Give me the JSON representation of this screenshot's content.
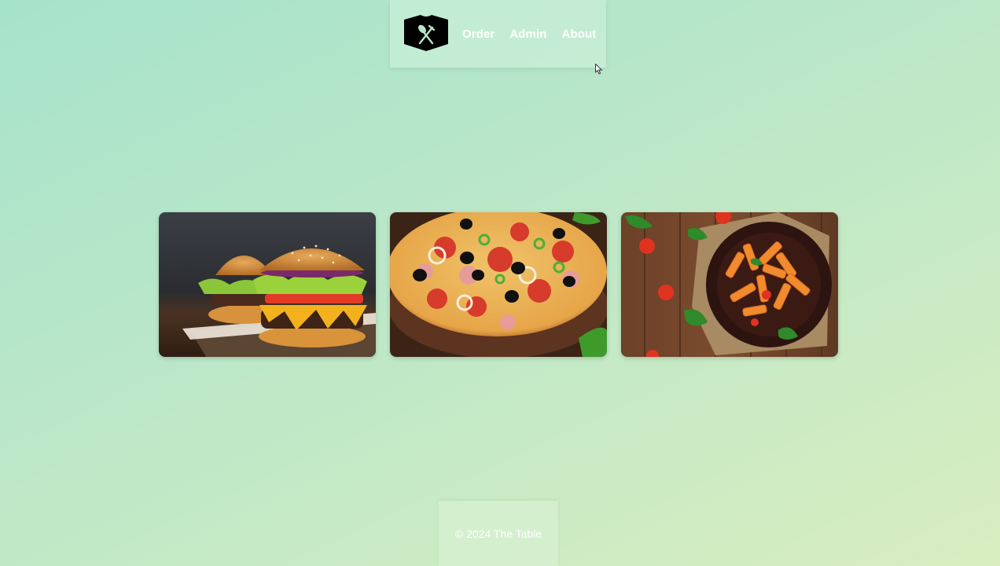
{
  "brand": {
    "logo_icon": "book-fork-spoon-icon"
  },
  "nav": {
    "items": [
      {
        "label": "Order"
      },
      {
        "label": "Admin"
      },
      {
        "label": "About"
      }
    ]
  },
  "gallery": {
    "images": [
      {
        "subject": "burger-image"
      },
      {
        "subject": "pizza-image"
      },
      {
        "subject": "pasta-image"
      }
    ]
  },
  "footer": {
    "text": "© 2024 The Table"
  },
  "colors": {
    "background_start": "#a6e3cb",
    "background_end": "#d9edc0",
    "nav_text": "#ffffff"
  }
}
